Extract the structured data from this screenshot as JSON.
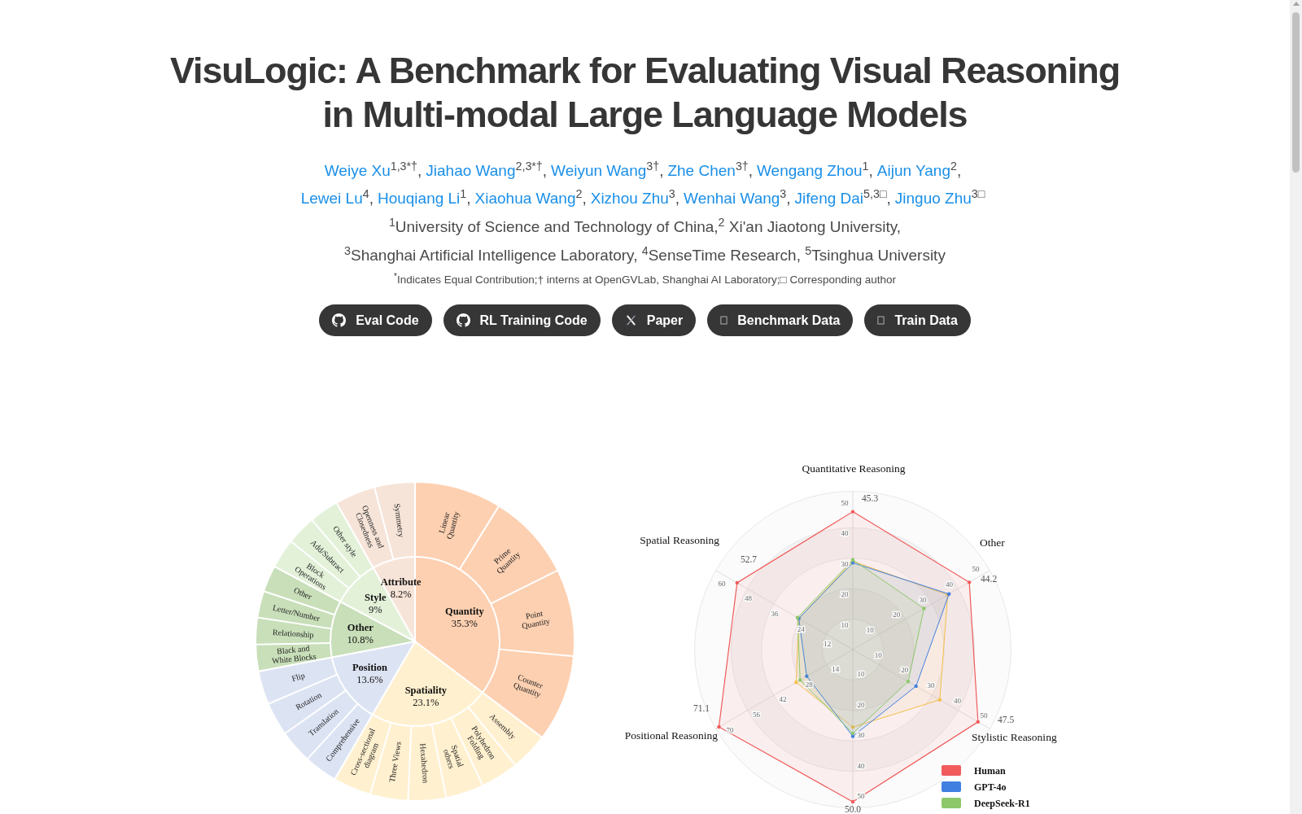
{
  "title": "VisuLogic: A Benchmark for Evaluating Visual Reasoning in Multi-modal Large Language Models",
  "author_lines": [
    [
      {
        "name": "Weiye Xu",
        "sup": "1,3*†",
        "trailing": ","
      },
      {
        "name": "Jiahao Wang",
        "sup": "2,3*†",
        "trailing": ","
      },
      {
        "name": "Weiyun Wang",
        "sup": "3†",
        "trailing": ","
      },
      {
        "name": "Zhe Chen",
        "sup": "3†",
        "trailing": ","
      },
      {
        "name": "Wengang Zhou",
        "sup": "1",
        "trailing": ","
      },
      {
        "name": "Aijun Yang",
        "sup": "2",
        "trailing": ","
      }
    ],
    [
      {
        "name": "Lewei Lu",
        "sup": "4",
        "trailing": ","
      },
      {
        "name": "Houqiang Li",
        "sup": "1",
        "trailing": ","
      },
      {
        "name": "Xiaohua Wang",
        "sup": "2",
        "trailing": ","
      },
      {
        "name": "Xizhou Zhu",
        "sup": "3",
        "trailing": ","
      },
      {
        "name": "Wenhai Wang",
        "sup": "3",
        "trailing": ","
      },
      {
        "name": "Jifeng Dai",
        "sup": "5,3□",
        "trailing": ","
      },
      {
        "name": "Jinguo Zhu",
        "sup": "3□"
      }
    ]
  ],
  "affiliations": [
    "$^{1}$University of Science and Technology of China,$^{2}$ Xi'an Jiaotong University,",
    "$^{3}$Shanghai Artificial Intelligence Laboratory, $^{4}$SenseTime Research, $^{5}$Tsinghua University"
  ],
  "footnote": "$^{*}$Indicates Equal Contribution;† interns at OpenGVLab, Shanghai AI Laboratory;□ Corresponding author",
  "buttons": [
    {
      "label": "Eval Code"
    },
    {
      "label": "RL Training Code"
    },
    {
      "label": "Paper"
    },
    {
      "label": "Benchmark Data"
    },
    {
      "label": "Train Data"
    }
  ],
  "pie_figure": {
    "chart_data": {
      "type": "pie",
      "categories": [
        "Quantity",
        "Spatiality",
        "Position",
        "Other",
        "Style",
        "Attribute"
      ],
      "values": [
        35.3,
        23.1,
        13.6,
        10.8,
        9,
        8.2
      ],
      "value_labels": [
        "35.3%",
        "23.1%",
        "13.6%",
        "10.8%",
        "9%",
        "8.2%"
      ]
    },
    "rings": [
      {
        "color": "#fdd0b1",
        "subcategories": [
          "Linear Quantity",
          "Prime Quantity",
          "Point Quantity",
          "Counter Quantity"
        ]
      },
      {
        "color": "#fff0cf",
        "subcategories": [
          "Assembly",
          "Polyhedron Folding",
          "Spatial others",
          "Hexahedron",
          "Three Views",
          "Cross-sectional diagram"
        ]
      },
      {
        "color": "#dce3f3",
        "subcategories": [
          "Comprehensive",
          "Translation",
          "Rotation",
          "Flip"
        ]
      },
      {
        "color": "#c8dfb9",
        "subcategories": [
          "Black and White Blocks",
          "Relationship",
          "Letter/Number",
          "Other"
        ]
      },
      {
        "color": "#e3f1d9",
        "subcategories": [
          "Block Operations",
          "Add/Subtract",
          "Other style"
        ]
      },
      {
        "color": "#f7e4d8",
        "subcategories": [
          "Openness and Closedness",
          "Symmetry"
        ]
      }
    ]
  },
  "radar_figure": {
    "axes": [
      {
        "label": "Quantitative Reasoning",
        "value_label": "45.3",
        "ticks": [
          "50",
          "40",
          "30",
          "20",
          "10"
        ]
      },
      {
        "label": "Spatial Reasoning",
        "value_label": "52.7",
        "ticks": [
          "60",
          "48",
          "36",
          "24",
          "12"
        ]
      },
      {
        "label": "Other",
        "value_label": "44.2",
        "ticks": [
          "50",
          "40",
          "30",
          "20",
          "10"
        ]
      },
      {
        "label": "Positional Reasoning",
        "value_label": "71.1",
        "ticks": [
          "14",
          "28",
          "42",
          "56",
          "70"
        ]
      },
      {
        "label": "Stylistic Reasoning",
        "value_label": "47.5",
        "ticks": [
          "10",
          "20",
          "30",
          "40",
          "50"
        ]
      },
      {
        "value_label": "50.0",
        "ticks": [
          "10",
          "20",
          "30",
          "40",
          "50"
        ]
      }
    ],
    "legend": [
      {
        "name": "Human",
        "color": "#f15b5b"
      },
      {
        "name": "GPT-4o",
        "color": "#4080e0"
      },
      {
        "name": "DeepSeek-R1",
        "color": "#8cc86a"
      }
    ]
  }
}
